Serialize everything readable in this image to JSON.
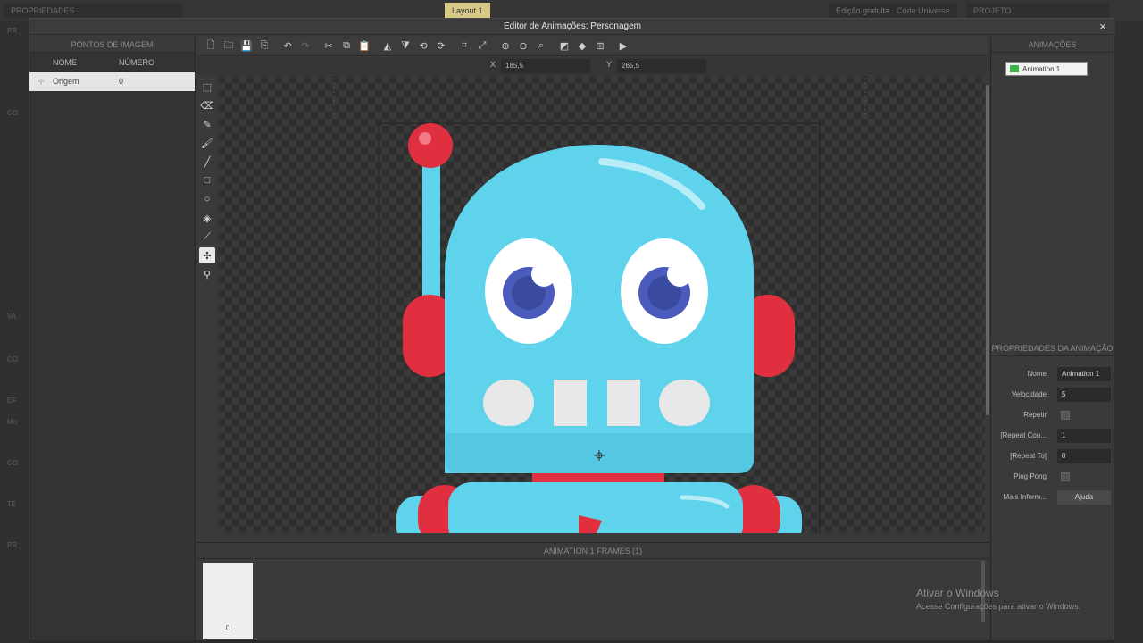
{
  "background": {
    "tabs": [
      "PROPRIEDADES",
      "Layout 1",
      "Edição gratuita",
      "Code Universe",
      "PROJETO"
    ],
    "left_labels": [
      "PR",
      "CO",
      "VA",
      "CO",
      "EF",
      "Mo",
      "CO",
      "TE",
      "PR"
    ]
  },
  "dialog": {
    "title": "Editor de Animações: Personagem",
    "close_label": "×"
  },
  "image_points": {
    "header": "PONTOS DE IMAGEM",
    "col_name": "NOME",
    "col_number": "NÚMERO",
    "rows": [
      {
        "name": "Origem",
        "number": "0"
      }
    ]
  },
  "toolbar": {
    "icons": [
      "new-file-icon",
      "open-folder-icon",
      "save-icon",
      "export-icon",
      "undo-icon",
      "redo-icon",
      "cut-icon",
      "copy-icon",
      "paste-icon",
      "flip-horizontal-icon",
      "flip-vertical-icon",
      "rotate-ccw-icon",
      "rotate-cw-icon",
      "crop-icon",
      "resize-icon",
      "zoom-in-icon",
      "zoom-out-icon",
      "zoom-reset-icon",
      "background-icon",
      "layers-icon",
      "grid-icon",
      "play-icon"
    ]
  },
  "coords": {
    "x_label": "X",
    "x_value": "185,5",
    "y_label": "Y",
    "y_value": "265,5"
  },
  "tools": [
    "select-tool-icon",
    "eraser-tool-icon",
    "pencil-tool-icon",
    "brush-tool-icon",
    "line-tool-icon",
    "rectangle-tool-icon",
    "ellipse-tool-icon",
    "fill-tool-icon",
    "eyedropper-tool-icon",
    "origin-point-tool-icon",
    "action-point-tool-icon"
  ],
  "animations": {
    "header": "ANIMAÇÕES",
    "items": [
      {
        "name": "Animation 1",
        "color": "#3ab54a"
      }
    ]
  },
  "animation_props": {
    "header": "PROPRIEDADES DA ANIMAÇÃO",
    "name_label": "Nome",
    "name_value": "Animation 1",
    "speed_label": "Velocidade",
    "speed_value": "5",
    "repeat_label": "Repetir",
    "repeat_count_label": "[Repeat Cou...",
    "repeat_count_value": "1",
    "repeat_to_label": "[Repeat To]",
    "repeat_to_value": "0",
    "pingpong_label": "Ping Pong",
    "more_info_label": "Mais Inform...",
    "help_button": "Ajuda"
  },
  "frames": {
    "header": "ANIMATION 1 FRAMES (1)",
    "items": [
      {
        "number": "0"
      }
    ]
  },
  "watermark": {
    "line1": "Ativar o Windows",
    "line2": "Acesse Configurações para ativar o Windows."
  },
  "colors": {
    "robot_body": "#5fd3ec",
    "robot_red": "#e0303f",
    "eye_iris": "#4a5bbd"
  }
}
